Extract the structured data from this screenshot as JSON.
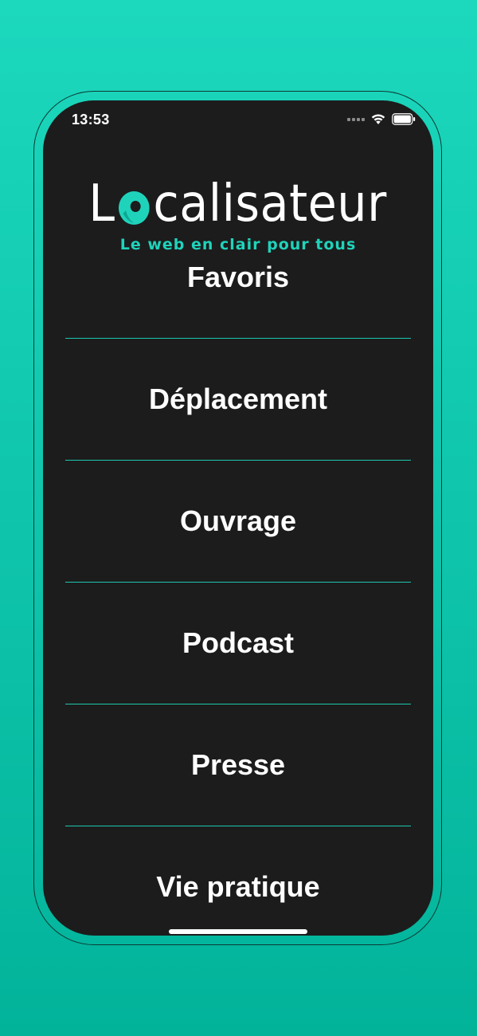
{
  "status_bar": {
    "time": "13:53"
  },
  "logo": {
    "word_start": "L",
    "word_end": "calisateur",
    "tagline": "Le web en clair pour tous",
    "accent_color": "#1fd3bb"
  },
  "menu": {
    "items": [
      {
        "label": "Favoris"
      },
      {
        "label": "Déplacement"
      },
      {
        "label": "Ouvrage"
      },
      {
        "label": "Podcast"
      },
      {
        "label": "Presse"
      },
      {
        "label": "Vie pratique"
      }
    ]
  },
  "icons": {
    "signal": "cellular-signal-icon",
    "wifi": "wifi-icon",
    "battery": "battery-icon",
    "logo_o": "location-pin-o-icon"
  },
  "colors": {
    "background_top": "#1cd8bd",
    "background_bottom": "#02b39a",
    "screen": "#1c1c1c",
    "divider": "#1cc7ae"
  }
}
